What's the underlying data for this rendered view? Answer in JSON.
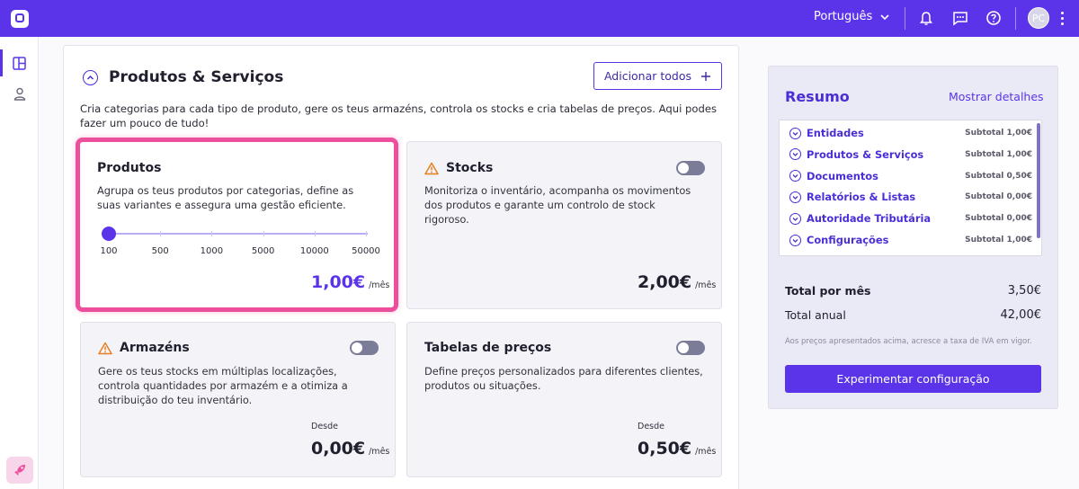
{
  "topbar": {
    "language": "Português",
    "avatar_initials": "PC",
    "icons": [
      "bell-icon",
      "chat-icon",
      "help-icon"
    ],
    "accent": "#5b34ea"
  },
  "section": {
    "title": "Produtos & Serviços",
    "add_all_label": "Adicionar todos",
    "description": "Cria categorias para cada tipo de produto, gere os teus armazéns, controla os stocks e cria tabelas de preços. Aqui podes fazer um pouco de tudo!"
  },
  "cards": {
    "produtos": {
      "title": "Produtos",
      "description": "Agrupa os teus produtos por categorias, define as suas variantes e assegura uma gestão eficiente.",
      "slider_ticks": [
        "100",
        "500",
        "1000",
        "5000",
        "10000",
        "50000"
      ],
      "slider_selected": "100",
      "price": "1,00€",
      "per": "/mês",
      "selected": true
    },
    "stocks": {
      "title": "Stocks",
      "description": "Monitoriza o inventário, acompanha os movimentos dos produtos e garante um controlo de stock rigoroso.",
      "price": "2,00€",
      "per": "/mês",
      "warning_icon": "warning-icon",
      "enabled": false
    },
    "armazens": {
      "title": "Armazéns",
      "description": "Gere os teus stocks em múltiplas localizações, controla quantidades por armazém e a otimiza a distribuição do teu inventário.",
      "from": "Desde",
      "price": "0,00€",
      "per": "/mês",
      "warning_icon": "warning-icon",
      "enabled": false
    },
    "tabelas": {
      "title": "Tabelas de preços",
      "description": "Define preços personalizados para diferentes clientes, produtos ou situações.",
      "from": "Desde",
      "price": "0,50€",
      "per": "/mês",
      "enabled": false
    }
  },
  "resumo": {
    "title": "Resumo",
    "details_link": "Mostrar detalhes",
    "items": [
      {
        "label": "Entidades",
        "subtotal": "Subtotal 1,00€"
      },
      {
        "label": "Produtos & Serviços",
        "subtotal": "Subtotal 1,00€"
      },
      {
        "label": "Documentos",
        "subtotal": "Subtotal 0,50€"
      },
      {
        "label": "Relatórios & Listas",
        "subtotal": "Subtotal 0,00€"
      },
      {
        "label": "Autoridade Tributária",
        "subtotal": "Subtotal 0,00€"
      },
      {
        "label": "Configurações",
        "subtotal": "Subtotal 1,00€"
      }
    ],
    "total_month_label": "Total por mês",
    "total_month_value": "3,50€",
    "total_year_label": "Total anual",
    "total_year_value": "42,00€",
    "note": "Aos preços apresentados acima, acresce a taxa de IVA em vigor.",
    "cta": "Experimentar configuração"
  }
}
